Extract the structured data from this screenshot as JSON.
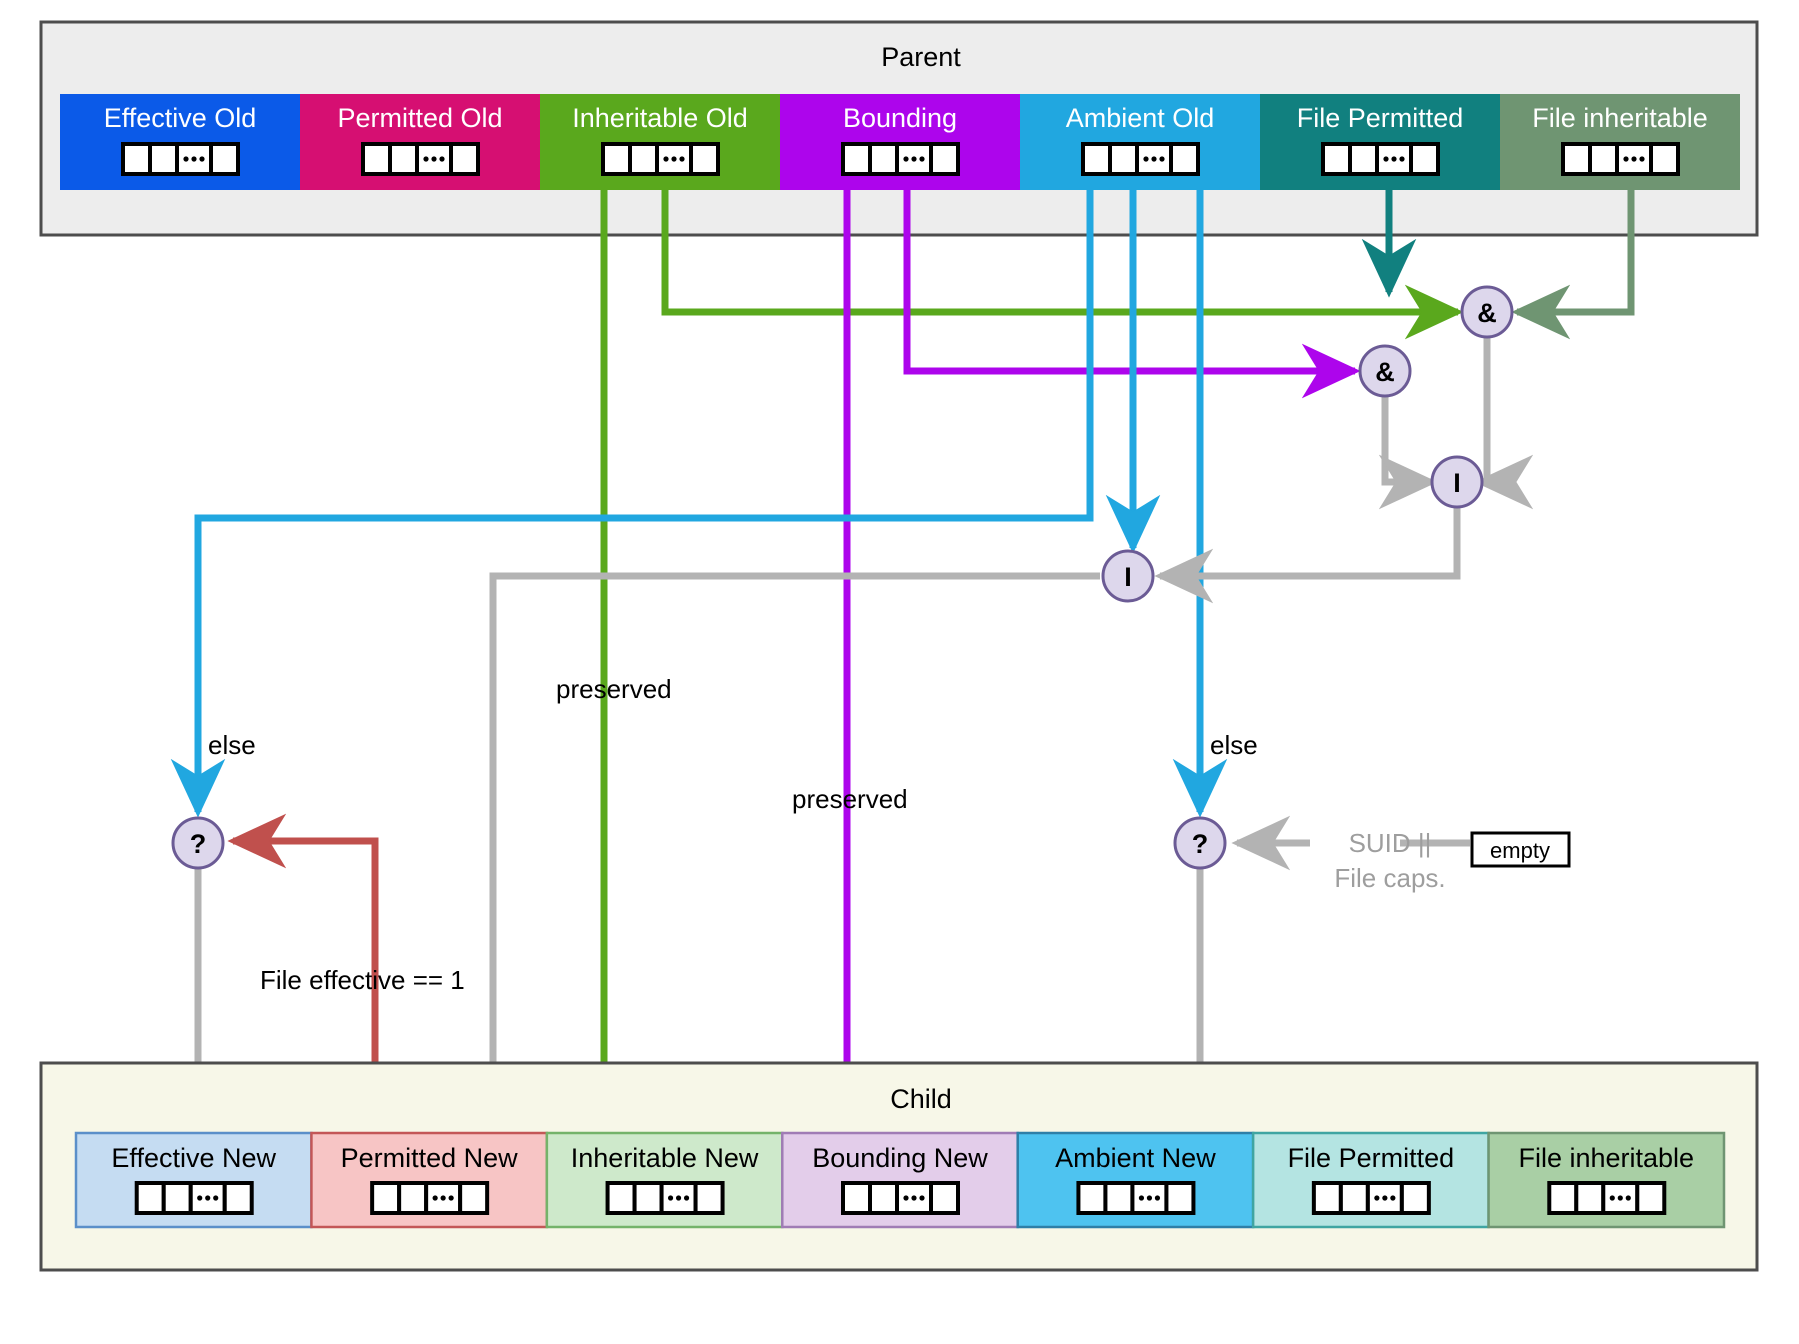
{
  "diagram": {
    "title_parent": "Parent",
    "title_child": "Child",
    "parent_boxes": [
      {
        "label": "Effective Old",
        "fill": "#0b5ae8",
        "text": "#ffffff",
        "cells": "placeholder-cells"
      },
      {
        "label": "Permitted Old",
        "fill": "#d60f72",
        "text": "#ffffff",
        "cells": "placeholder-cells"
      },
      {
        "label": "Inheritable Old",
        "fill": "#5aa81d",
        "text": "#ffffff",
        "cells": "placeholder-cells"
      },
      {
        "label": "Bounding",
        "fill": "#ad05ec",
        "text": "#ffffff",
        "cells": "placeholder-cells"
      },
      {
        "label": "Ambient Old",
        "fill": "#21a7e0",
        "text": "#ffffff",
        "cells": "placeholder-cells"
      },
      {
        "label": "File Permitted",
        "fill": "#11807f",
        "text": "#ffffff",
        "cells": "placeholder-cells"
      },
      {
        "label": "File inheritable",
        "fill": "#6f9572",
        "text": "#ffffff",
        "cells": "placeholder-cells"
      }
    ],
    "child_boxes": [
      {
        "label": "Effective New",
        "fill": "#c5dcf2",
        "stroke": "#5b8fc9",
        "text": "#000000",
        "cells": "placeholder-cells"
      },
      {
        "label": "Permitted New",
        "fill": "#f7c5c5",
        "stroke": "#c35757",
        "text": "#000000",
        "cells": "placeholder-cells"
      },
      {
        "label": "Inheritable New",
        "fill": "#cee9cb",
        "stroke": "#74b36a",
        "text": "#000000",
        "cells": "placeholder-cells"
      },
      {
        "label": "Bounding New",
        "fill": "#e3cdea",
        "stroke": "#a islands",
        "text": "#000000",
        "cells": "placeholder-cells"
      },
      {
        "label": "Ambient New",
        "fill": "#4ec3f0",
        "stroke": "#7f7fb0",
        "text": "#000000",
        "cells": "placeholder-cells"
      },
      {
        "label": "File Permitted",
        "fill": "#b4e4e2",
        "stroke": "#3fa5a2",
        "text": "#000000",
        "cells": "placeholder-cells"
      },
      {
        "label": "File inheritable",
        "fill": "#a9cfa5",
        "stroke": "#6f9572",
        "text": "#000000",
        "cells": "placeholder-cells"
      }
    ],
    "operator_nodes": [
      {
        "id": "and-1",
        "glyph": "&"
      },
      {
        "id": "and-2",
        "glyph": "&"
      },
      {
        "id": "or-1",
        "glyph": "I"
      },
      {
        "id": "or-2",
        "glyph": "I"
      },
      {
        "id": "cond-1",
        "glyph": "?"
      },
      {
        "id": "cond-2",
        "glyph": "?"
      }
    ],
    "edge_labels": [
      {
        "id": "else-left",
        "text": "else"
      },
      {
        "id": "else-right",
        "text": "else"
      },
      {
        "id": "preserved-inheritable",
        "text": "preserved"
      },
      {
        "id": "preserved-bounding",
        "text": "preserved"
      },
      {
        "id": "file-effective",
        "text": "File effective == 1"
      },
      {
        "id": "suid-line1",
        "text": "SUID ||"
      },
      {
        "id": "suid-line2",
        "text": "File caps."
      }
    ],
    "empty_box": {
      "label": "empty"
    },
    "colors": {
      "parent_bg": "#ededed",
      "child_bg": "#f7f7e8",
      "frame": "#4d4d4d",
      "gray_edge": "#b3b3b3",
      "red_edge": "#c0504d",
      "green_edge": "#5aa81d",
      "purple_edge": "#ad05ec",
      "blue_edge": "#21a7e0",
      "teal_edge": "#11807f",
      "olive_edge": "#6f9572",
      "node_fill": "#ddd7ec",
      "node_stroke": "#6b5b95"
    }
  }
}
